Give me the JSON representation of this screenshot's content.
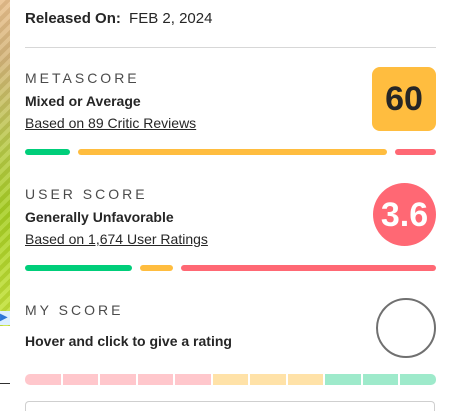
{
  "release": {
    "label": "Released On:",
    "value": "FEB 2, 2024"
  },
  "metascore": {
    "title": "METASCORE",
    "verdict": "Mixed or Average",
    "link": "Based on 89 Critic Reviews",
    "score": "60",
    "score_color": "#FFBD3F",
    "distribution": [
      {
        "label": "positive",
        "fraction": 0.11,
        "color": "#00CE7A"
      },
      {
        "label": "mixed",
        "fraction": 0.76,
        "color": "#FFBD3F"
      },
      {
        "label": "negative",
        "fraction": 0.1,
        "color": "#FF6874"
      }
    ]
  },
  "user_score": {
    "title": "USER SCORE",
    "verdict": "Generally Unfavorable",
    "link": "Based on 1,674 User Ratings",
    "score": "3.6",
    "score_color": "#FF6874",
    "distribution": [
      {
        "label": "positive",
        "fraction": 0.26,
        "color": "#00CE7A"
      },
      {
        "label": "mixed",
        "fraction": 0.08,
        "color": "#FFBD3F"
      },
      {
        "label": "negative",
        "fraction": 0.62,
        "color": "#FF6874"
      }
    ]
  },
  "my_score": {
    "title": "MY SCORE",
    "prompt": "Hover and click to give a rating",
    "scale": [
      {
        "value": 0,
        "color": "#FFC7CC"
      },
      {
        "value": 1,
        "color": "#FFC7CC"
      },
      {
        "value": 2,
        "color": "#FFC7CC"
      },
      {
        "value": 3,
        "color": "#FFC7CC"
      },
      {
        "value": 4,
        "color": "#FFC7CC"
      },
      {
        "value": 5,
        "color": "#FFE2A8"
      },
      {
        "value": 6,
        "color": "#FFE2A8"
      },
      {
        "value": 7,
        "color": "#FFE2A8"
      },
      {
        "value": 8,
        "color": "#9EEACB"
      },
      {
        "value": 9,
        "color": "#9EEACB"
      },
      {
        "value": 10,
        "color": "#9EEACB"
      }
    ]
  }
}
